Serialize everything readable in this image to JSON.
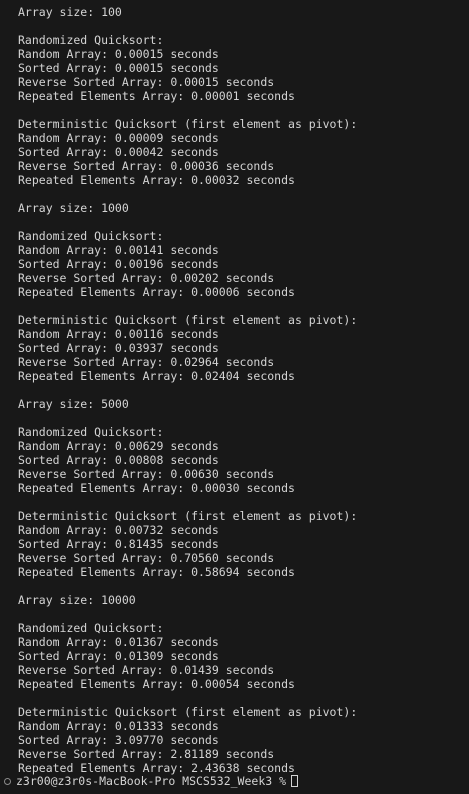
{
  "terminal": {
    "lines": [
      "Array size: 100",
      "",
      "Randomized Quicksort:",
      "Random Array: 0.00015 seconds",
      "Sorted Array: 0.00015 seconds",
      "Reverse Sorted Array: 0.00015 seconds",
      "Repeated Elements Array: 0.00001 seconds",
      "",
      "Deterministic Quicksort (first element as pivot):",
      "Random Array: 0.00009 seconds",
      "Sorted Array: 0.00042 seconds",
      "Reverse Sorted Array: 0.00036 seconds",
      "Repeated Elements Array: 0.00032 seconds",
      "",
      "Array size: 1000",
      "",
      "Randomized Quicksort:",
      "Random Array: 0.00141 seconds",
      "Sorted Array: 0.00196 seconds",
      "Reverse Sorted Array: 0.00202 seconds",
      "Repeated Elements Array: 0.00006 seconds",
      "",
      "Deterministic Quicksort (first element as pivot):",
      "Random Array: 0.00116 seconds",
      "Sorted Array: 0.03937 seconds",
      "Reverse Sorted Array: 0.02964 seconds",
      "Repeated Elements Array: 0.02404 seconds",
      "",
      "Array size: 5000",
      "",
      "Randomized Quicksort:",
      "Random Array: 0.00629 seconds",
      "Sorted Array: 0.00808 seconds",
      "Reverse Sorted Array: 0.00630 seconds",
      "Repeated Elements Array: 0.00030 seconds",
      "",
      "Deterministic Quicksort (first element as pivot):",
      "Random Array: 0.00732 seconds",
      "Sorted Array: 0.81435 seconds",
      "Reverse Sorted Array: 0.70560 seconds",
      "Repeated Elements Array: 0.58694 seconds",
      "",
      "Array size: 10000",
      "",
      "Randomized Quicksort:",
      "Random Array: 0.01367 seconds",
      "Sorted Array: 0.01309 seconds",
      "Reverse Sorted Array: 0.01439 seconds",
      "Repeated Elements Array: 0.00054 seconds",
      "",
      "Deterministic Quicksort (first element as pivot):",
      "Random Array: 0.01333 seconds",
      "Sorted Array: 3.09770 seconds",
      "Reverse Sorted Array: 2.81189 seconds",
      "Repeated Elements Array: 2.43638 seconds"
    ],
    "prompt": "z3r00@z3r0s-MacBook-Pro MSCS532_Week3 %",
    "colors": {
      "background": "#181818",
      "text": "#d4d4d4",
      "marker": "#8a8a8a"
    },
    "icons": {
      "prompt_marker": "circle-outline-icon",
      "cursor": "block-cursor-icon"
    }
  }
}
